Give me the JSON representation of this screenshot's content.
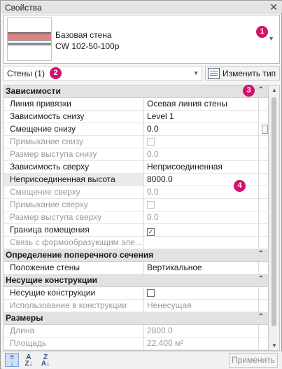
{
  "window": {
    "title": "Свойства"
  },
  "type_selector": {
    "family": "Базовая стена",
    "type": "CW 102-50-100p"
  },
  "instance": {
    "label": "Стены (1)",
    "edit_type_label": "Изменить тип"
  },
  "badges": [
    "1",
    "2",
    "3",
    "4"
  ],
  "sections": {
    "constraints": {
      "title": "Зависимости",
      "rows": [
        {
          "name": "Линия привязки",
          "value": "Осевая линия стены"
        },
        {
          "name": "Зависимость снизу",
          "value": "Level 1"
        },
        {
          "name": "Смещение снизу",
          "value": "0.0"
        },
        {
          "name": "Примыкание снизу",
          "checked": false
        },
        {
          "name": "Размер выступа снизу",
          "value": "0.0"
        },
        {
          "name": "Зависимость сверху",
          "value": "Неприсоединенная"
        },
        {
          "name": "Неприсоединенная высота",
          "value": "8000.0"
        },
        {
          "name": "Смещение сверху",
          "value": "0.0"
        },
        {
          "name": "Примыкание сверху",
          "checked": false
        },
        {
          "name": "Размер выступа сверху",
          "value": "0.0"
        },
        {
          "name": "Граница помещения",
          "checked": true
        },
        {
          "name": "Связь с формообразующим эле..."
        }
      ]
    },
    "cross_section": {
      "title": "Определение поперечного сечения",
      "rows": [
        {
          "name": "Положение стены",
          "value": "Вертикальное"
        }
      ]
    },
    "structural": {
      "title": "Несущие конструкции",
      "rows": [
        {
          "name": "Несущие конструкции",
          "checked": false
        },
        {
          "name": "Использование в конструкции",
          "value": "Ненесущая"
        }
      ]
    },
    "dimensions": {
      "title": "Размеры",
      "rows": [
        {
          "name": "Длина",
          "value": "2800.0"
        },
        {
          "name": "Площадь",
          "value": "22.400 м²"
        }
      ]
    }
  },
  "apply_label": "Применить",
  "colors": {
    "badge": "#d4116d",
    "active_tool": "#cfe0f5"
  }
}
